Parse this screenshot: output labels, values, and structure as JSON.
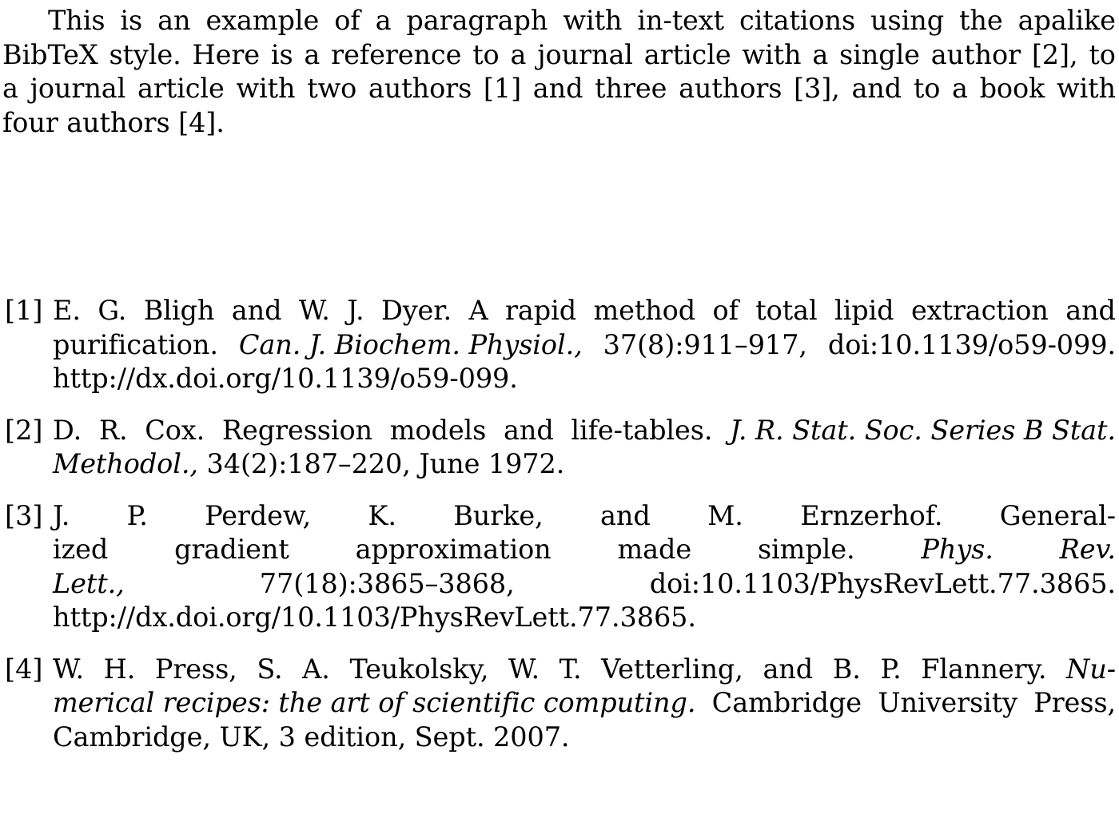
{
  "document": {
    "type": "latex-bibliography-example",
    "background_color": "#ffffff",
    "text_color": "#000000",
    "paragraph": {
      "full_text": "This is an example of a paragraph with in-text citations using the apalike BibTeX style. Here is a reference to a journal article with a single author [2], to a journal article with two authors [1] and three authors [3], and to a book with four authors [4].",
      "lines": [
        {
          "indent": true,
          "words": [
            "This",
            "is",
            "an",
            "example",
            "of",
            "a",
            "paragraph",
            "with",
            "in-text",
            "citations",
            "using",
            "the",
            "apalike"
          ]
        },
        {
          "indent": false,
          "words": [
            "BibTeX",
            "style.",
            "Here",
            "is",
            "a",
            "reference",
            "to",
            "a",
            "journal",
            "article",
            "with",
            "a",
            "single",
            "author",
            "[2],",
            "to"
          ]
        },
        {
          "indent": false,
          "words": [
            "a",
            "journal",
            "article",
            "with",
            "two",
            "authors",
            "[1]",
            "and",
            "three",
            "authors",
            "[3],",
            "and",
            "to",
            "a",
            "book",
            "with"
          ]
        },
        {
          "indent": false,
          "last": true,
          "text": "four authors [4]."
        }
      ]
    },
    "bibliography": {
      "entries": [
        {
          "label": "[1]",
          "number": "1",
          "authors": "E. G. Bligh and W. J. Dyer.",
          "title": "A rapid method of total lipid extraction and purification.",
          "journal": "Can. J. Biochem. Physiol.,",
          "volume_issue_pages": "37(8):911–917,",
          "doi": "doi:10.1139/o59-099.",
          "url": "http://dx.doi.org/10.1139/o59-099.",
          "lines": [
            {
              "justified": true,
              "parts": [
                {
                  "text": "E.",
                  "style": "roman"
                },
                {
                  "text": "G.",
                  "style": "roman"
                },
                {
                  "text": "Bligh",
                  "style": "roman"
                },
                {
                  "text": "and",
                  "style": "roman"
                },
                {
                  "text": "W.",
                  "style": "roman"
                },
                {
                  "text": "J.",
                  "style": "roman"
                },
                {
                  "text": "Dyer.",
                  "style": "roman"
                },
                {
                  "text": "A",
                  "style": "roman"
                },
                {
                  "text": "rapid",
                  "style": "roman"
                },
                {
                  "text": "method",
                  "style": "roman"
                },
                {
                  "text": "of",
                  "style": "roman"
                },
                {
                  "text": "total",
                  "style": "roman"
                },
                {
                  "text": "lipid",
                  "style": "roman"
                },
                {
                  "text": "extraction",
                  "style": "roman"
                },
                {
                  "text": "and",
                  "style": "roman"
                }
              ]
            },
            {
              "justified": true,
              "parts": [
                {
                  "text": "purification.",
                  "style": "roman"
                },
                {
                  "text": "Can. J. Biochem. Physiol.,",
                  "style": "italic"
                },
                {
                  "text": "37(8):911–917,",
                  "style": "roman"
                },
                {
                  "text": "doi:10.1139/o59-099.",
                  "style": "roman"
                }
              ]
            },
            {
              "justified": false,
              "text": "http://dx.doi.org/10.1139/o59-099."
            }
          ]
        },
        {
          "label": "[2]",
          "number": "2",
          "authors": "D. R. Cox.",
          "title": "Regression models and life-tables.",
          "journal": "J. R. Stat. Soc. Series B Stat. Methodol.,",
          "volume_issue_pages": "34(2):187–220,",
          "date": "June 1972.",
          "lines": [
            {
              "justified": true,
              "parts": [
                {
                  "text": "D.",
                  "style": "roman"
                },
                {
                  "text": "R.",
                  "style": "roman"
                },
                {
                  "text": "Cox.",
                  "style": "roman"
                },
                {
                  "text": "Regression",
                  "style": "roman"
                },
                {
                  "text": "models",
                  "style": "roman"
                },
                {
                  "text": "and",
                  "style": "roman"
                },
                {
                  "text": "life-tables.",
                  "style": "roman"
                },
                {
                  "text": "J. R. Stat. Soc. Series B Stat.",
                  "style": "italic"
                }
              ]
            },
            {
              "justified": false,
              "parts": [
                {
                  "text": "Methodol.,",
                  "style": "italic"
                },
                {
                  "text": " 34(2):187–220, June 1972.",
                  "style": "roman"
                }
              ]
            }
          ]
        },
        {
          "label": "[3]",
          "number": "3",
          "authors": "J. P. Perdew, K. Burke, and M. Ernzerhof.",
          "title": "Generalized gradient approximation made simple.",
          "journal": "Phys. Rev. Lett.,",
          "volume_issue_pages": "77(18):3865–3868,",
          "doi": "doi:10.1103/PhysRevLett.77.3865.",
          "url": "http://dx.doi.org/10.1103/PhysRevLett.77.3865.",
          "lines": [
            {
              "justified": true,
              "parts": [
                {
                  "text": "J.",
                  "style": "roman"
                },
                {
                  "text": "P.",
                  "style": "roman"
                },
                {
                  "text": "Perdew,",
                  "style": "roman"
                },
                {
                  "text": "K.",
                  "style": "roman"
                },
                {
                  "text": "Burke,",
                  "style": "roman"
                },
                {
                  "text": "and",
                  "style": "roman"
                },
                {
                  "text": "M.",
                  "style": "roman"
                },
                {
                  "text": "Ernzerhof.",
                  "style": "roman"
                },
                {
                  "text": "General-",
                  "style": "roman"
                }
              ]
            },
            {
              "justified": true,
              "parts": [
                {
                  "text": "ized",
                  "style": "roman"
                },
                {
                  "text": "gradient",
                  "style": "roman"
                },
                {
                  "text": "approximation",
                  "style": "roman"
                },
                {
                  "text": "made",
                  "style": "roman"
                },
                {
                  "text": "simple.",
                  "style": "roman"
                },
                {
                  "text": "Phys.",
                  "style": "italic"
                },
                {
                  "text": "Rev.",
                  "style": "italic"
                }
              ]
            },
            {
              "justified": true,
              "parts": [
                {
                  "text": "Lett.,",
                  "style": "italic"
                },
                {
                  "text": "77(18):3865–3868,",
                  "style": "roman"
                },
                {
                  "text": "doi:10.1103/PhysRevLett.77.3865.",
                  "style": "roman"
                }
              ]
            },
            {
              "justified": false,
              "text": "http://dx.doi.org/10.1103/PhysRevLett.77.3865."
            }
          ]
        },
        {
          "label": "[4]",
          "number": "4",
          "authors": "W. H. Press, S. A. Teukolsky, W. T. Vetterling, and B. P. Flannery.",
          "title": "Numerical recipes: the art of scientific computing.",
          "publisher": "Cambridge University Press, Cambridge, UK,",
          "edition": "3 edition,",
          "date": "Sept. 2007.",
          "lines": [
            {
              "justified": true,
              "parts": [
                {
                  "text": "W.",
                  "style": "roman"
                },
                {
                  "text": "H.",
                  "style": "roman"
                },
                {
                  "text": "Press,",
                  "style": "roman"
                },
                {
                  "text": "S.",
                  "style": "roman"
                },
                {
                  "text": "A.",
                  "style": "roman"
                },
                {
                  "text": "Teukolsky,",
                  "style": "roman"
                },
                {
                  "text": "W.",
                  "style": "roman"
                },
                {
                  "text": "T.",
                  "style": "roman"
                },
                {
                  "text": "Vetterling,",
                  "style": "roman"
                },
                {
                  "text": "and",
                  "style": "roman"
                },
                {
                  "text": "B.",
                  "style": "roman"
                },
                {
                  "text": "P.",
                  "style": "roman"
                },
                {
                  "text": "Flannery.",
                  "style": "roman"
                },
                {
                  "text": "Nu-",
                  "style": "italic"
                }
              ]
            },
            {
              "justified": true,
              "parts": [
                {
                  "text": "merical recipes: the art of scientific computing.",
                  "style": "italic"
                },
                {
                  "text": "Cambridge",
                  "style": "roman"
                },
                {
                  "text": "University",
                  "style": "roman"
                },
                {
                  "text": "Press,",
                  "style": "roman"
                }
              ]
            },
            {
              "justified": false,
              "text": "Cambridge, UK, 3 edition, Sept. 2007."
            }
          ]
        }
      ]
    }
  }
}
